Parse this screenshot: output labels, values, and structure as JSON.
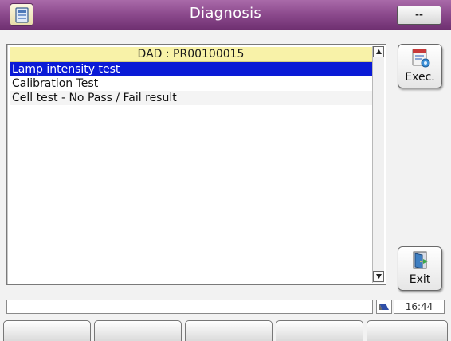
{
  "window": {
    "title": "Diagnosis",
    "menu_button_label": "--",
    "app_icon": "document-icon"
  },
  "list": {
    "header": "DAD : PR00100015",
    "items": [
      {
        "label": "Lamp intensity test",
        "selected": true
      },
      {
        "label": "Calibration Test",
        "selected": false
      },
      {
        "label": "Cell test - No Pass / Fail result",
        "selected": false
      }
    ]
  },
  "side_buttons": {
    "exec": {
      "label": "Exec.",
      "icon": "execute-icon"
    },
    "exit": {
      "label": "Exit",
      "icon": "exit-door-icon"
    }
  },
  "status": {
    "message": "",
    "indicator_icon": "network-icon",
    "time": "16:44"
  },
  "softkeys": [
    "",
    "",
    "",
    "",
    ""
  ],
  "colors": {
    "title_bar": "#8d4b8e",
    "list_header": "#f8f2a8",
    "selection": "#0a1ad6"
  }
}
